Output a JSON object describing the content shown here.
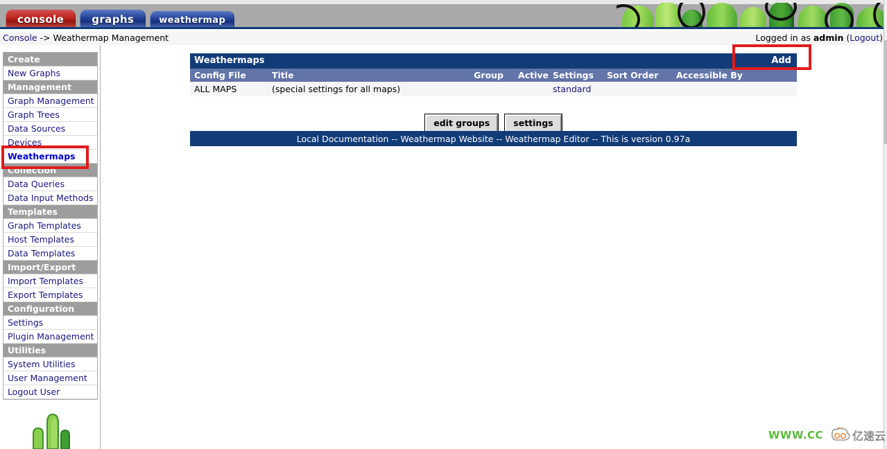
{
  "app": {
    "tabs": [
      {
        "label": "console",
        "state": "active",
        "color": "#c12a22"
      },
      {
        "label": "graphs",
        "state": "inactive",
        "color": "#29479c"
      },
      {
        "label": "weathermap",
        "state": "inactive",
        "color": "#29479c"
      }
    ]
  },
  "breadcrumb": {
    "root_link": "Console",
    "separator": " -> ",
    "current": "Weathermap Management"
  },
  "session": {
    "prefix": "Logged in as ",
    "user": "admin",
    "logout_label": "Logout",
    "logout_open": " (",
    "logout_close": ")"
  },
  "sidebar": {
    "sections": [
      {
        "type": "header",
        "label": "Create"
      },
      {
        "type": "item",
        "label": "New Graphs",
        "selected": false
      },
      {
        "type": "header",
        "label": "Management"
      },
      {
        "type": "item",
        "label": "Graph Management",
        "selected": false
      },
      {
        "type": "item",
        "label": "Graph Trees",
        "selected": false
      },
      {
        "type": "item",
        "label": "Data Sources",
        "selected": false
      },
      {
        "type": "item",
        "label": "Devices",
        "selected": false
      },
      {
        "type": "item",
        "label": "Weathermaps",
        "selected": true
      },
      {
        "type": "header",
        "label": "Collection Methods"
      },
      {
        "type": "item",
        "label": "Data Queries",
        "selected": false
      },
      {
        "type": "item",
        "label": "Data Input Methods",
        "selected": false
      },
      {
        "type": "header",
        "label": "Templates"
      },
      {
        "type": "item",
        "label": "Graph Templates",
        "selected": false
      },
      {
        "type": "item",
        "label": "Host Templates",
        "selected": false
      },
      {
        "type": "item",
        "label": "Data Templates",
        "selected": false
      },
      {
        "type": "header",
        "label": "Import/Export"
      },
      {
        "type": "item",
        "label": "Import Templates",
        "selected": false
      },
      {
        "type": "item",
        "label": "Export Templates",
        "selected": false
      },
      {
        "type": "header",
        "label": "Configuration"
      },
      {
        "type": "item",
        "label": "Settings",
        "selected": false
      },
      {
        "type": "item",
        "label": "Plugin Management",
        "selected": false
      },
      {
        "type": "header",
        "label": "Utilities"
      },
      {
        "type": "item",
        "label": "System Utilities",
        "selected": false
      },
      {
        "type": "item",
        "label": "User Management",
        "selected": false
      },
      {
        "type": "item",
        "label": "Logout User",
        "selected": false
      }
    ],
    "logo_icon": "cactus-icon"
  },
  "main": {
    "panel": {
      "title": "Weathermaps",
      "add_label": "Add",
      "columns": [
        {
          "key": "config_file",
          "label": "Config File"
        },
        {
          "key": "title",
          "label": "Title"
        },
        {
          "key": "group",
          "label": "Group"
        },
        {
          "key": "active",
          "label": "Active"
        },
        {
          "key": "settings",
          "label": "Settings"
        },
        {
          "key": "sort_order",
          "label": "Sort Order"
        },
        {
          "key": "accessible_by",
          "label": "Accessible By"
        }
      ],
      "rows": [
        {
          "config_file": "ALL MAPS",
          "title": "(special settings for all maps)",
          "group": "",
          "active": "",
          "settings": "standard",
          "sort_order": "",
          "accessible_by": ""
        }
      ]
    },
    "buttons": [
      {
        "label": "edit groups"
      },
      {
        "label": "settings"
      }
    ],
    "footer_text": "Local Documentation -- Weathermap Website -- Weathermap Editor -- This is version 0.97a"
  },
  "annotations": [
    {
      "name": "weathermaps-menu-highlight",
      "color": "#e01b1b"
    },
    {
      "name": "add-link-highlight",
      "color": "#e01b1b"
    }
  ],
  "watermark": {
    "text": "WWW.CC",
    "cn_text": "亿速云",
    "text_color": "#5bbb3a",
    "logo_icon": "cloud-icon"
  },
  "colors": {
    "panel_title_bg": "#123c78",
    "column_header_bg": "#6274a8",
    "link": "#17167e",
    "menu_header_bg": "#9d9d9d",
    "banner_bg": "#a9a9a9"
  }
}
